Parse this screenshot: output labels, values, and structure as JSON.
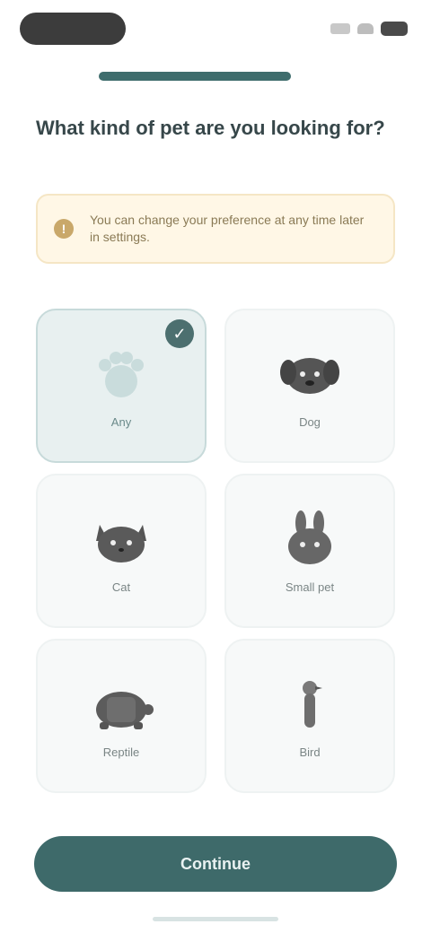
{
  "progress": {
    "fraction": 1.0
  },
  "question": {
    "title": "What kind of pet are you looking for?"
  },
  "alert": {
    "icon": "info-icon",
    "text": "You can change your preference at any time later in settings."
  },
  "options": [
    {
      "label": "Any",
      "icon": "paw-icon",
      "selected": true
    },
    {
      "label": "Dog",
      "icon": "dog-icon",
      "selected": false
    },
    {
      "label": "Cat",
      "icon": "cat-icon",
      "selected": false
    },
    {
      "label": "Small pet",
      "icon": "rabbit-icon",
      "selected": false
    },
    {
      "label": "Reptile",
      "icon": "turtle-icon",
      "selected": false
    },
    {
      "label": "Bird",
      "icon": "bird-icon",
      "selected": false
    }
  ],
  "button": {
    "label": "Continue"
  },
  "colors": {
    "accent": "#3e6a6a",
    "selected_bg": "#e8f0f0",
    "alert_bg": "#fff7e6"
  }
}
